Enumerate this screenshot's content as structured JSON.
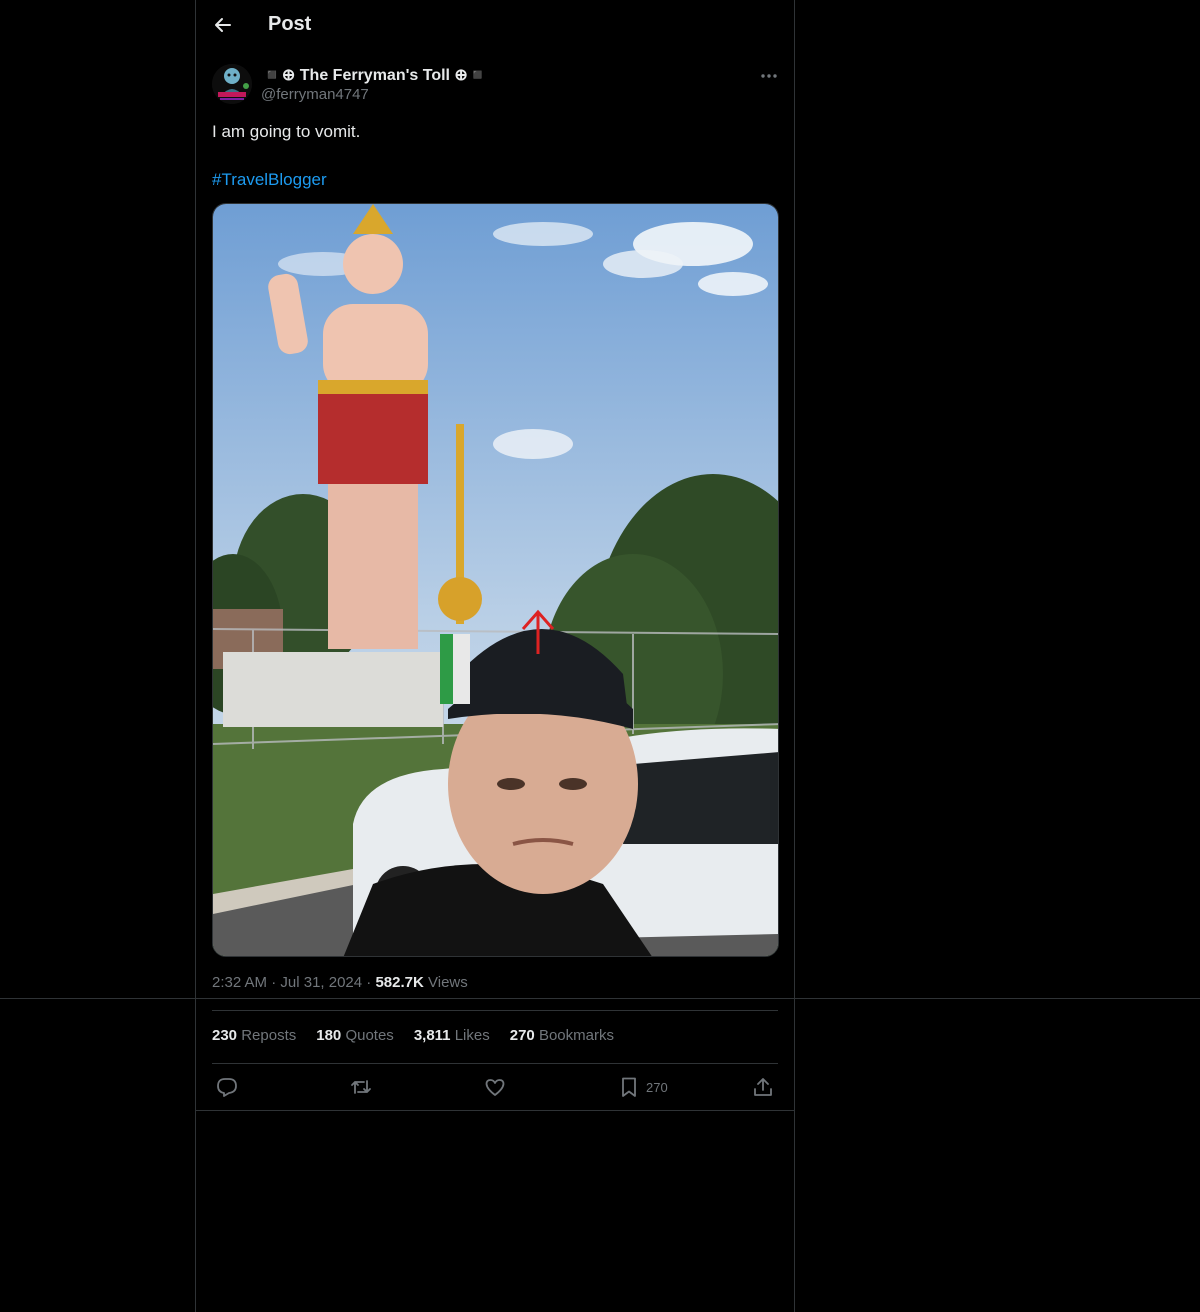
{
  "header": {
    "title": "Post"
  },
  "author": {
    "display_name": "◾⊕ The Ferryman's Toll ⊕◾",
    "handle": "@ferryman4747"
  },
  "tweet": {
    "text": "I am going to vomit.",
    "hashtag": "#TravelBlogger"
  },
  "meta": {
    "time": "2:32 AM",
    "date": "Jul 31, 2024",
    "views_count": "582.7K",
    "views_label": "Views"
  },
  "stats": {
    "reposts_count": "230",
    "reposts_label": "Reposts",
    "quotes_count": "180",
    "quotes_label": "Quotes",
    "likes_count": "3,811",
    "likes_label": "Likes",
    "bookmarks_count": "270",
    "bookmarks_label": "Bookmarks"
  },
  "actions": {
    "bookmark_count": "270"
  },
  "colors": {
    "accent": "#1d9bf0",
    "muted": "#71767b",
    "text": "#e7e9ea",
    "border": "#2f3336",
    "background": "#000000"
  },
  "icons": [
    "back-arrow-icon",
    "more-icon",
    "reply-icon",
    "repost-icon",
    "like-icon",
    "bookmark-icon",
    "share-icon"
  ]
}
